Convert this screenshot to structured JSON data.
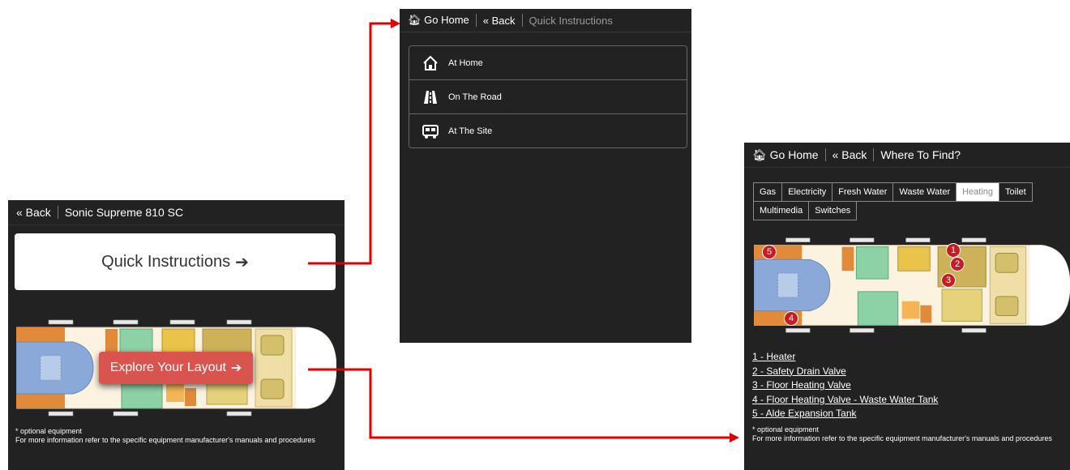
{
  "panel_a": {
    "back": "« Back",
    "title": "Sonic Supreme 810 SC",
    "quick_instructions": "Quick Instructions",
    "explore_layout": "Explore Your Layout",
    "footnote_1": "* optional equipment",
    "footnote_2": "For more information refer to the specific equipment manufacturer's manuals and procedures"
  },
  "panel_b": {
    "go_home": "Go Home",
    "back": "« Back",
    "title": "Quick Instructions",
    "menu": [
      {
        "label": "At Home",
        "icon": "house-icon"
      },
      {
        "label": "On The Road",
        "icon": "road-icon"
      },
      {
        "label": "At The Site",
        "icon": "campervan-icon"
      }
    ]
  },
  "panel_c": {
    "go_home": "Go Home",
    "back": "« Back",
    "title": "Where To Find?",
    "tabs": [
      "Gas",
      "Electricity",
      "Fresh Water",
      "Waste Water",
      "Heating",
      "Toilet",
      "Multimedia",
      "Switches"
    ],
    "active_tab": "Heating",
    "markers": [
      "1",
      "2",
      "3",
      "4",
      "5"
    ],
    "legend": [
      "1 - Heater",
      "2 - Safety Drain Valve",
      "3 - Floor Heating Valve",
      "4 - Floor Heating Valve - Waste Water Tank",
      "5 - Alde Expansion Tank"
    ],
    "footnote_1": "* optional equipment",
    "footnote_2": "For more information refer to the specific equipment manufacturer's manuals and procedures"
  },
  "colors": {
    "panel_bg": "#222222",
    "explore_button": "#d9534f",
    "arrow": "#e00000",
    "marker": "#c81c24"
  }
}
